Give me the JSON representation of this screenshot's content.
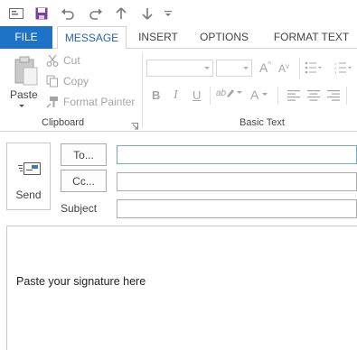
{
  "quick_access": {
    "icons": [
      "mail-icon",
      "save-icon",
      "undo-icon",
      "redo-icon",
      "up-arrow-icon",
      "down-arrow-icon",
      "customize-dropdown-icon"
    ]
  },
  "tabs": [
    {
      "label": "FILE"
    },
    {
      "label": "MESSAGE",
      "active": true
    },
    {
      "label": "INSERT"
    },
    {
      "label": "OPTIONS"
    },
    {
      "label": "FORMAT TEXT"
    }
  ],
  "ribbon": {
    "clipboard": {
      "paste": "Paste",
      "cut": "Cut",
      "copy": "Copy",
      "format_painter": "Format Painter",
      "label": "Clipboard"
    },
    "basic_text": {
      "label": "Basic Text",
      "bold": "B",
      "italic": "I",
      "underline": "U",
      "grow_font": "A",
      "shrink_font": "A",
      "font_color": "A",
      "highlight": "ab"
    }
  },
  "compose": {
    "send": "Send",
    "to_button": "To...",
    "cc_button": "Cc...",
    "subject_label": "Subject",
    "to_value": "",
    "cc_value": "",
    "subject_value": "",
    "body_text": "Paste your signature here"
  },
  "colors": {
    "file_tab": "#1e72c8",
    "active_tab_text": "#2b62a8",
    "save_icon": "#7b3f99"
  }
}
